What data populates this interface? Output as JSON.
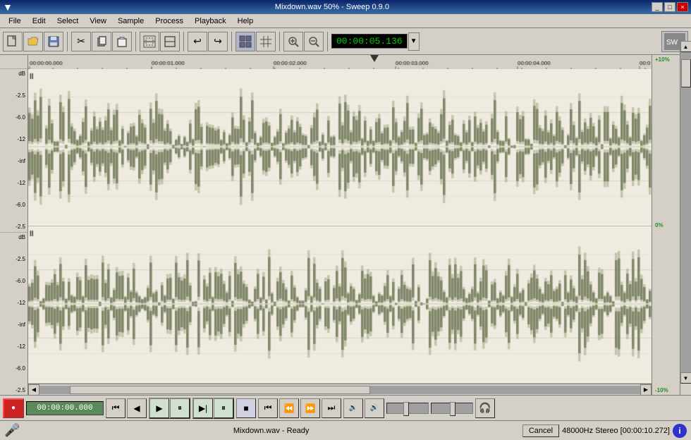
{
  "titleBar": {
    "title": "Mixdown.wav 50% - Sweep 0.9.0",
    "winControls": [
      "_",
      "□",
      "×"
    ]
  },
  "menuBar": {
    "items": [
      "File",
      "Edit",
      "Select",
      "View",
      "Sample",
      "Process",
      "Playback",
      "Help"
    ]
  },
  "toolbar": {
    "timeDisplay": "00:00:05.136",
    "tooltips": {
      "open": "Open",
      "save": "Save",
      "cut": "Cut",
      "copy": "Copy",
      "paste": "Paste",
      "undo": "Undo",
      "redo": "Redo"
    }
  },
  "timeline": {
    "markers": [
      {
        "time": "00:00:00.000",
        "pos": 0
      },
      {
        "time": "00:00:01.000",
        "pos": 175
      },
      {
        "time": "00:00:02.000",
        "pos": 348
      },
      {
        "time": "00:00:03.000",
        "pos": 521
      },
      {
        "time": "00:00:04.000",
        "pos": 694
      },
      {
        "time": "00:0",
        "pos": 867
      }
    ]
  },
  "percentScale": {
    "top": "+10%",
    "mid": "0%",
    "bottom": "-10%"
  },
  "dbScale": {
    "labels": [
      "dB",
      "-2.5",
      "-6.0",
      "-12",
      "-inf",
      "-12",
      "-6.0",
      "-2.5"
    ]
  },
  "transport": {
    "timeDisplay": "00:00:00.000",
    "recLabel": "●",
    "buttons": [
      "◀◀",
      "◀",
      "▶",
      "▶◀",
      "■",
      "◀◀",
      "◀",
      "▶",
      "▶▶"
    ]
  },
  "statusBar": {
    "text": "Mixdown.wav - Ready",
    "cancelBtn": "Cancel",
    "infoText": "48000Hz Stereo [00:00:10.272]",
    "infoIcon": "i"
  }
}
